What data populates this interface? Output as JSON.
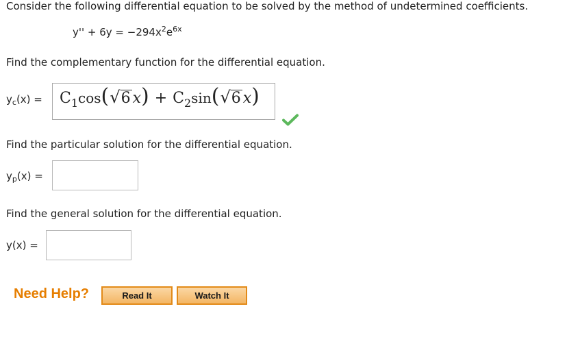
{
  "question": {
    "intro": "Consider the following differential equation to be solved by the method of undetermined coefficients.",
    "equation": {
      "lhs": "y'' + 6y = −294x",
      "x_exponent": "2",
      "e": "e",
      "e_exponent": "6x"
    }
  },
  "part_complementary": {
    "prompt": "Find the complementary function for the differential equation.",
    "label_var": "y",
    "label_sub": "c",
    "label_rest": "(x) =",
    "answer": {
      "c1": "C",
      "c1_sub": "1",
      "fn1": "cos",
      "radicand1": "6",
      "var1": "x",
      "plus": "+",
      "c2": "C",
      "c2_sub": "2",
      "fn2": "sin",
      "radicand2": "6",
      "var2": "x"
    },
    "status_icon": "checkmark-icon",
    "status_color": "#5cb85c"
  },
  "part_particular": {
    "prompt": "Find the particular solution for the differential equation.",
    "label_var": "y",
    "label_sub": "p",
    "label_rest": "(x) =",
    "value": ""
  },
  "part_general": {
    "prompt": "Find the general solution for the differential equation.",
    "label": "y(x) =",
    "value": ""
  },
  "help": {
    "title": "Need Help?",
    "read_label": "Read It",
    "watch_label": "Watch It",
    "accent_color": "#e67e00"
  }
}
